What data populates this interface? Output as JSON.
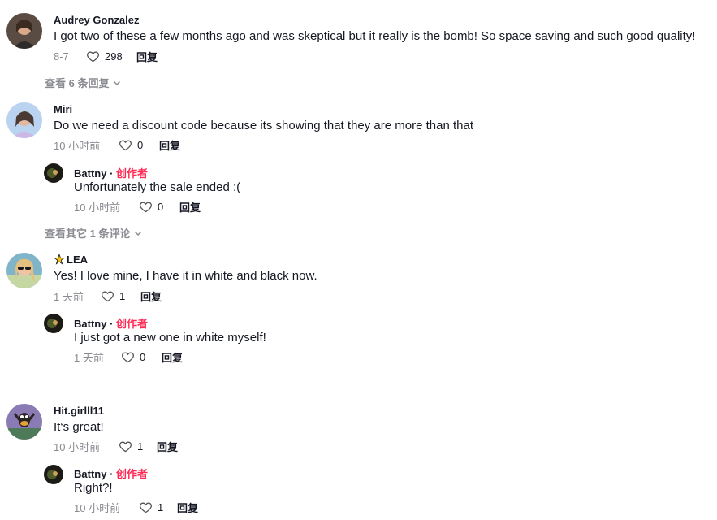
{
  "ui": {
    "reply_label": "回复",
    "creator_label": "创作者",
    "separator": "·"
  },
  "comments": [
    {
      "username": "Audrey Gonzalez",
      "text": "I got two of these a few months ago and was skeptical but it really is the bomb! So space saving and such good quality!",
      "date": "8-7",
      "likes": "298",
      "more": "查看 6 条回复"
    },
    {
      "username": "Miri",
      "text": "Do we need a discount code because its showing that they are more than that",
      "date": "10 小时前",
      "likes": "0",
      "more": "查看其它 1 条评论",
      "reply": {
        "username": "Battny",
        "text": "Unfortunately the sale ended :(",
        "date": "10 小时前",
        "likes": "0"
      }
    },
    {
      "username": "LEA",
      "text": "Yes! I love mine, I have it in white and black now.",
      "date": "1 天前",
      "likes": "1",
      "reply": {
        "username": "Battny",
        "text": "I just got a new one in white myself!",
        "date": "1 天前",
        "likes": "0"
      }
    },
    {
      "username": "Hit.girlll11",
      "text": "It‘s great!",
      "date": "10 小时前",
      "likes": "1",
      "reply": {
        "username": "Battny",
        "text": "Right?!",
        "date": "10 小时前",
        "likes": "1"
      }
    }
  ],
  "icons": {
    "like": "heart-outline-icon",
    "expand": "chevron-down-icon",
    "badge": "sparkle-star-icon"
  }
}
